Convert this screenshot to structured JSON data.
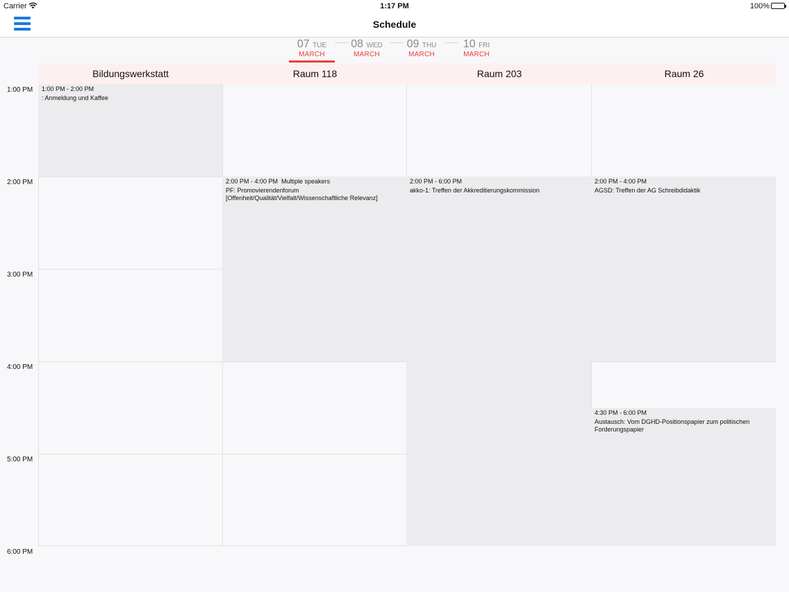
{
  "status_bar": {
    "carrier": "Carrier",
    "time": "1:17 PM",
    "battery": "100%"
  },
  "nav": {
    "title": "Schedule",
    "menu_icon": "hamburger-icon"
  },
  "days": [
    {
      "num": "07",
      "dow": "TUE",
      "month": "MARCH",
      "selected": true
    },
    {
      "num": "08",
      "dow": "WED",
      "month": "MARCH",
      "selected": false
    },
    {
      "num": "09",
      "dow": "THU",
      "month": "MARCH",
      "selected": false
    },
    {
      "num": "10",
      "dow": "FRI",
      "month": "MARCH",
      "selected": false
    }
  ],
  "rooms": [
    "Bildungswerkstatt",
    "Raum 118",
    "Raum 203",
    "Raum 26"
  ],
  "time_labels": [
    "1:00 PM",
    "2:00 PM",
    "3:00 PM",
    "4:00 PM",
    "5:00 PM",
    "6:00 PM"
  ],
  "events": [
    {
      "room": 0,
      "start": 13.0,
      "end": 14.0,
      "time": "1:00 PM - 2:00 PM",
      "title": ": Anmeldung und Kaffee"
    },
    {
      "room": 1,
      "start": 14.0,
      "end": 16.0,
      "time": "2:00 PM - 4:00 PM  Multiple speakers",
      "title": "PF: Promovierendenforum [Offenheit/Qualität/Vielfalt/Wissenschaftliche Relevanz]"
    },
    {
      "room": 2,
      "start": 14.0,
      "end": 18.0,
      "time": "2:00 PM - 6:00 PM",
      "title": "akko-1: Treffen der Akkreditierungskommission"
    },
    {
      "room": 3,
      "start": 14.0,
      "end": 16.0,
      "time": "2:00 PM - 4:00 PM",
      "title": "AGSD: Treffen der AG Schreibdidaktik"
    },
    {
      "room": 3,
      "start": 16.5,
      "end": 18.0,
      "time": "4:30 PM - 6:00 PM",
      "title": "Austausch: Vom DGHD-Positionspapier zum politischen Forderungspapier"
    }
  ],
  "colors": {
    "accent_red": "#e8413a",
    "menu_blue": "#1a7ad9",
    "header_tint": "#fdf0f1",
    "event_bg": "#ececee"
  }
}
